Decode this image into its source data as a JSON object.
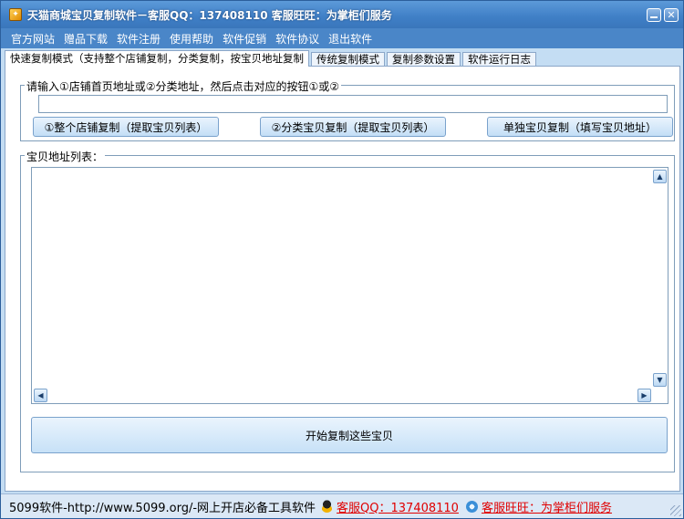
{
  "window": {
    "title": "天猫商城宝贝复制软件－客服QQ：137408110 客服旺旺：为掌柜们服务",
    "minimize_label": "_",
    "close_label": "✕"
  },
  "menu": [
    "官方网站",
    "赠品下载",
    "软件注册",
    "使用帮助",
    "软件促销",
    "软件协议",
    "退出软件"
  ],
  "tabs": [
    {
      "label": "快速复制模式（支持整个店铺复制，分类复制，按宝贝地址复制",
      "active": true
    },
    {
      "label": "传统复制模式",
      "active": false
    },
    {
      "label": "复制参数设置",
      "active": false
    },
    {
      "label": "软件运行日志",
      "active": false
    }
  ],
  "input_group": {
    "legend": "请输入①店铺首页地址或②分类地址，然后点击对应的按钮①或②",
    "url_value": "",
    "buttons": {
      "whole_shop": "①整个店铺复制（提取宝贝列表）",
      "category": "②分类宝贝复制（提取宝贝列表）",
      "single": "单独宝贝复制（填写宝贝地址）"
    }
  },
  "list_group": {
    "legend": "宝贝地址列表：",
    "start_button": "开始复制这些宝贝"
  },
  "status": {
    "text": "5099软件-http://www.5099.org/-网上开店必备工具软件",
    "qq_link": "客服QQ：137408110",
    "ww_link": "客服旺旺：为掌柜们服务"
  },
  "colors": {
    "titlebar": "#3f7fc6",
    "menubar": "#4a86c8",
    "link": "#e00000"
  }
}
